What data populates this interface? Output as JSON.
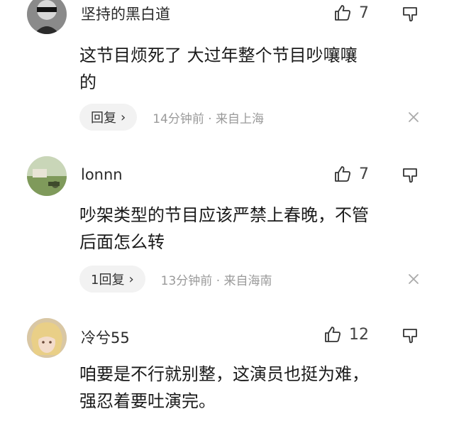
{
  "comments": [
    {
      "username": "坚持的黑白道",
      "likes": "7",
      "avatar_icon": "avatar-dark-icon",
      "lines": [
        "这节目烦死了 大过年整个节目吵嚷嚷",
        "的"
      ],
      "reply_label": "回复",
      "time": "14分钟前 · 来自上海"
    },
    {
      "username": "lonnn",
      "likes": "7",
      "avatar_icon": "avatar-landscape-icon",
      "lines": [
        "吵架类型的节目应该严禁上春晚，不管",
        "后面怎么转"
      ],
      "reply_label": "1回复",
      "time": "13分钟前 · 来自海南"
    },
    {
      "username": "冷兮55",
      "likes": "12",
      "avatar_icon": "avatar-anime-icon",
      "lines": [
        "咱要是不行就别整，这演员也挺为难，",
        "强忍着要吐演完。"
      ]
    }
  ],
  "colors": {
    "accent_text": "#1a1a1a",
    "meta_text": "#9a9a9a",
    "reply_bg": "#f2f2f2"
  }
}
